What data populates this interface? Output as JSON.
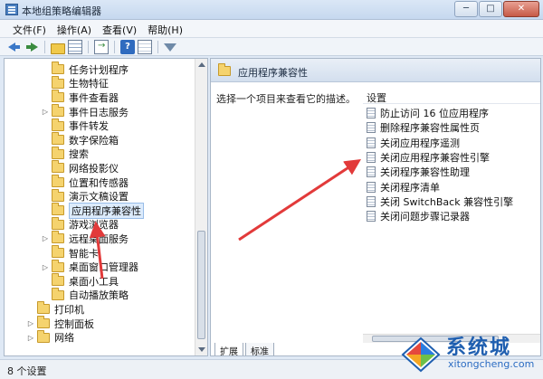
{
  "window": {
    "title": "本地组策略编辑器",
    "min": "─",
    "max": "□",
    "close": "✕"
  },
  "menu": [
    "文件(F)",
    "操作(A)",
    "查看(V)",
    "帮助(H)"
  ],
  "toolbar": {
    "icons": [
      "back-arrow-icon",
      "forward-arrow-icon",
      "folder-up-icon",
      "show-hide-tree-icon",
      "export-list-icon",
      "help-icon",
      "properties-icon",
      "filter-icon"
    ],
    "help_label": "?"
  },
  "tree": {
    "items": [
      {
        "label": "任务计划程序",
        "expander": "",
        "selected": false
      },
      {
        "label": "生物特征",
        "expander": "",
        "selected": false
      },
      {
        "label": "事件查看器",
        "expander": "",
        "selected": false
      },
      {
        "label": "事件日志服务",
        "expander": "▷",
        "selected": false
      },
      {
        "label": "事件转发",
        "expander": "",
        "selected": false
      },
      {
        "label": "数字保险箱",
        "expander": "",
        "selected": false
      },
      {
        "label": "搜索",
        "expander": "",
        "selected": false
      },
      {
        "label": "网络投影仪",
        "expander": "",
        "selected": false
      },
      {
        "label": "位置和传感器",
        "expander": "",
        "selected": false
      },
      {
        "label": "演示文稿设置",
        "expander": "",
        "selected": false
      },
      {
        "label": "应用程序兼容性",
        "expander": "",
        "selected": true
      },
      {
        "label": "游戏浏览器",
        "expander": "",
        "selected": false
      },
      {
        "label": "远程桌面服务",
        "expander": "▷",
        "selected": false
      },
      {
        "label": "智能卡",
        "expander": "",
        "selected": false
      },
      {
        "label": "桌面窗口管理器",
        "expander": "▷",
        "selected": false
      },
      {
        "label": "桌面小工具",
        "expander": "",
        "selected": false
      },
      {
        "label": "自动播放策略",
        "expander": "",
        "selected": false
      },
      {
        "label": "打印机",
        "expander": "",
        "selected": false
      },
      {
        "label": "控制面板",
        "expander": "▷",
        "selected": false
      },
      {
        "label": "网络",
        "expander": "▷",
        "selected": false
      }
    ]
  },
  "right": {
    "header_title": "应用程序兼容性",
    "description": "选择一个项目来查看它的描述。",
    "settings_header": "设置",
    "settings": [
      "防止访问 16 位应用程序",
      "删除程序兼容性属性页",
      "关闭应用程序遥测",
      "关闭应用程序兼容性引擎",
      "关闭程序兼容性助理",
      "关闭程序清单",
      "关闭 SwitchBack 兼容性引擎",
      "关闭问题步骤记录器"
    ],
    "tabs": [
      "扩展",
      "标准"
    ]
  },
  "status": {
    "text": "8 个设置"
  },
  "watermark": {
    "brand": "系统城",
    "url": "xitongcheng.com"
  },
  "colors": {
    "arrow": "#e23a3a",
    "selection": "#dcebfc",
    "accent": "#1f5fb0"
  }
}
